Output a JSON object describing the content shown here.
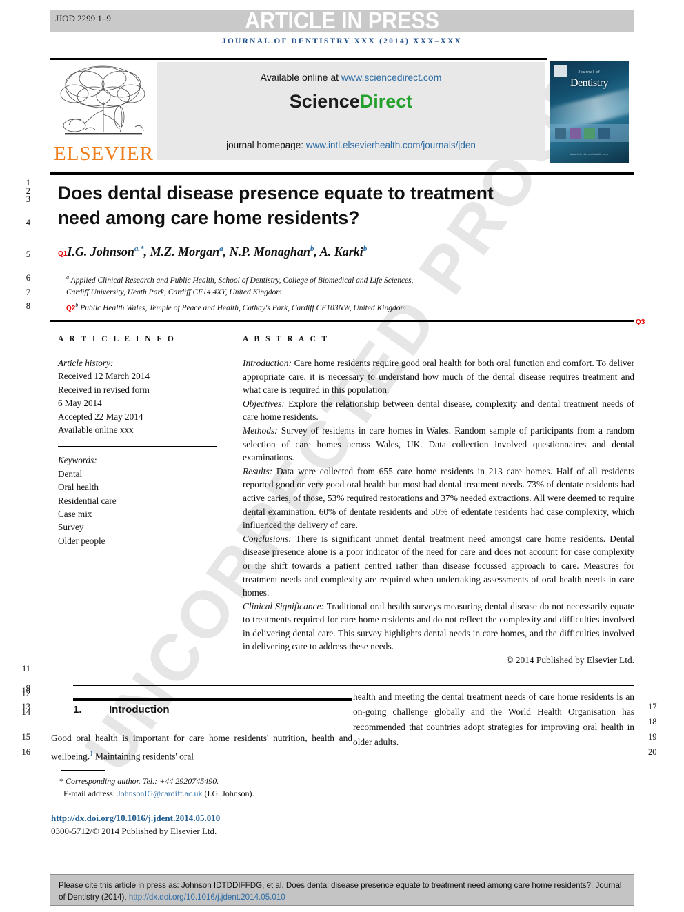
{
  "banner": {
    "code": "JJOD 2299 1–9",
    "article_in_press": "ARTICLE IN PRESS",
    "journal_line": "JOURNAL OF DENTISTRY XXX (2014) XXX–XXX"
  },
  "sciencedirect": {
    "available_label": "Available online at",
    "available_url": "www.sciencedirect.com",
    "logo_science": "Science",
    "logo_direct": "Direct",
    "homepage_label": "journal homepage:",
    "homepage_url": "www.intl.elsevierhealth.com/journals/jden"
  },
  "publisher": {
    "elsevier_wordmark": "ELSEVIER"
  },
  "cover": {
    "sub": "Journal of",
    "title": "Dentistry",
    "footer": "www.intl.elsevierhealth.com"
  },
  "article": {
    "title_line1": "Does dental disease presence equate to treatment",
    "title_line2": "need among care home residents?",
    "authors_html": "I.G. Johnson, M.Z. Morgan, N.P. Monaghan, A. Karki",
    "authors": [
      {
        "name": "I.G. Johnson",
        "marks": "a,*"
      },
      {
        "name": "M.Z. Morgan",
        "marks": "a"
      },
      {
        "name": "N.P. Monaghan",
        "marks": "b"
      },
      {
        "name": "A. Karki",
        "marks": "b"
      }
    ],
    "affiliation_a_line1": "Applied Clinical Research and Public Health, School of Dentistry, College of Biomedical and Life Sciences,",
    "affiliation_a_line2": "Cardiff University, Heath Park, Cardiff CF14 4XY, United Kingdom",
    "affiliation_b": "Public Health Wales, Temple of Peace and Health, Cathay's Park, Cardiff CF103NW, United Kingdom",
    "query_tags": {
      "q1": "Q1",
      "q2": "Q2",
      "q3": "Q3"
    }
  },
  "info": {
    "heading": "A R T I C L E   I N F O",
    "history_label": "Article history:",
    "history": [
      "Received 12 March 2014",
      "Received in revised form",
      "6 May 2014",
      "Accepted 22 May 2014",
      "Available online xxx"
    ],
    "keywords_label": "Keywords:",
    "keywords": [
      "Dental",
      "Oral health",
      "Residential care",
      "Case mix",
      "Survey",
      "Older people"
    ]
  },
  "abstract": {
    "heading": "A B S T R A C T",
    "sections": [
      {
        "label": "Introduction:",
        "text": " Care home residents require good oral health for both oral function and comfort. To deliver appropriate care, it is necessary to understand how much of the dental disease requires treatment and what care is required in this population."
      },
      {
        "label": "Objectives:",
        "text": " Explore the relationship between dental disease, complexity and dental treatment needs of care home residents."
      },
      {
        "label": "Methods:",
        "text": " Survey of residents in care homes in Wales. Random sample of participants from a random selection of care homes across Wales, UK. Data collection involved questionnaires and dental examinations."
      },
      {
        "label": "Results:",
        "text": " Data were collected from 655 care home residents in 213 care homes. Half of all residents reported good or very good oral health but most had dental treatment needs. 73% of dentate residents had active caries, of those, 53% required restorations and 37% needed extractions. All were deemed to require dental examination. 60% of dentate residents and 50% of edentate residents had case complexity, which influenced the delivery of care."
      },
      {
        "label": "Conclusions:",
        "text": " There is significant unmet dental treatment need amongst care home residents. Dental disease presence alone is a poor indicator of the need for care and does not account for case complexity or the shift towards a patient centred rather than disease focussed approach to care. Measures for treatment needs and complexity are required when undertaking assessments of oral health needs in care homes."
      },
      {
        "label": "Clinical Significance:",
        "text": " Traditional oral health surveys measuring dental disease do not necessarily equate to treatments required for care home residents and do not reflect the complexity and difficulties involved in delivering dental care. This survey highlights dental needs in care homes, and the difficulties involved in delivering care to address these needs."
      }
    ],
    "copyright": "© 2014 Published by Elsevier Ltd."
  },
  "introduction": {
    "number": "1.",
    "title": "Introduction",
    "left_text": "Good oral health is important for care home residents' nutrition, health and wellbeing.",
    "left_ref": "1",
    "left_text_cont": " Maintaining residents' oral",
    "right_text": "health and meeting the dental treatment needs of care home residents is an on-going challenge globally and the World Health Organisation has recommended that countries adopt strategies for improving oral health in older adults."
  },
  "footnote": {
    "star": "*",
    "corresponding": "Corresponding author. Tel.: +44 2920745490.",
    "email_label": "E-mail address:",
    "email": "JohnsonIG@cardiff.ac.uk",
    "email_suffix": "(I.G. Johnson)."
  },
  "doi_block": {
    "doi_url": "http://dx.doi.org/10.1016/j.jdent.2014.05.010",
    "issn_line": "0300-5712/© 2014 Published by Elsevier Ltd."
  },
  "citation": {
    "text_part1": "Please cite this article in press as: Johnson IDTDDIFFDG, et al. Does dental disease presence equate to treatment need among care home residents?. Journal of Dentistry (2014), ",
    "link": "http://dx.doi.org/10.1016/j.jdent.2014.05.010"
  },
  "watermark": {
    "text": "UNCORRECTED PROOF"
  },
  "line_numbers": {
    "left": [
      "1",
      "2",
      "3",
      "4",
      "5",
      "6",
      "7",
      "8",
      "11",
      "9",
      "10",
      "12",
      "13",
      "14",
      "15",
      "16"
    ],
    "right": [
      "17",
      "18",
      "19",
      "20"
    ]
  },
  "colors": {
    "link": "#2e6ca4",
    "journal_line": "#1f4e8c",
    "science_direct_green": "#22a02b",
    "elsevier_orange": "#ef7d1a",
    "query_red": "#e60000",
    "banner_grey": "#c9c9c9",
    "sd_box_grey": "#e8e8e8",
    "cite_box_grey": "#c4c4c4"
  }
}
